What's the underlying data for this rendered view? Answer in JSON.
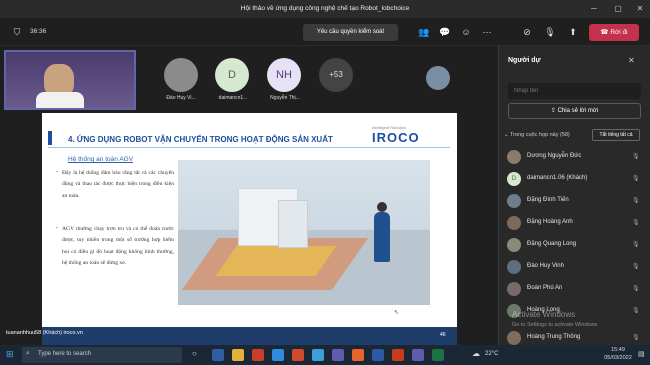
{
  "window": {
    "title": "Hội thảo về ứng dụng công nghệ chế tạo Robot_Iobchoice"
  },
  "toolbar": {
    "timer": "36:36",
    "request_control": "Yêu cầu quyền kiểm soát",
    "leave": "Rời đi"
  },
  "participants_strip": [
    {
      "label": "Đào Huy Vi...",
      "initial": ""
    },
    {
      "label": "daimancn1...",
      "initial": "D"
    },
    {
      "label": "Nguyễn Thị...",
      "initial": "NH"
    },
    {
      "label": "",
      "initial": "+53"
    }
  ],
  "presenter": {
    "name": "tuananhhuu58 (Khách)",
    "url": "iroco.vn"
  },
  "slide": {
    "title": "4. ỨNG DỤNG ROBOT VẬN CHUYỂN TRONG HOẠT ĐỘNG SẢN XUẤT",
    "brand": "IROCO",
    "brand_tagline": "Intelligent Robotics",
    "subtitle": "Hệ thống an toàn AGV",
    "bullet1": "Đây là hệ thống đảm bảo rằng tất cả các chuyển động và thao tác được thực hiện trong điều kiện an toàn.",
    "bullet2": "AGV thường chạy trơn tru và có thể đoán trước được, tuy nhiên trong một số trường hợp hiếm hoi có điều gì đó hoạt động không bình thường, hệ thống an toàn sẽ dừng xe.",
    "page": "46"
  },
  "panel": {
    "title": "Người dự",
    "search_placeholder": "Nhập tên",
    "share_invite": "Chia sẻ lời mời",
    "section": "Trong cuộc họp này (58)",
    "mute_all": "Tắt tiếng tất cả",
    "people": [
      "Dương Nguyễn Đức",
      "daimancn1.06 (Khách)",
      "Đặng Đình Tiến",
      "Đặng Hoàng Anh",
      "Đặng Quang Long",
      "Đào Huy Vinh",
      "Đoàn Phú An",
      "Hoàng Long",
      "Hoàng Trung Thông"
    ],
    "activate_windows": "Activate Windows",
    "activate_hint": "Go to Settings to activate Windows."
  },
  "taskbar": {
    "search": "Type here to search",
    "weather": "22°C",
    "time": "15:49",
    "date": "05/03/2022"
  },
  "colors": {
    "accent": "#6264a7",
    "leave": "#c4314b",
    "slide_title": "#1d4fa0"
  }
}
